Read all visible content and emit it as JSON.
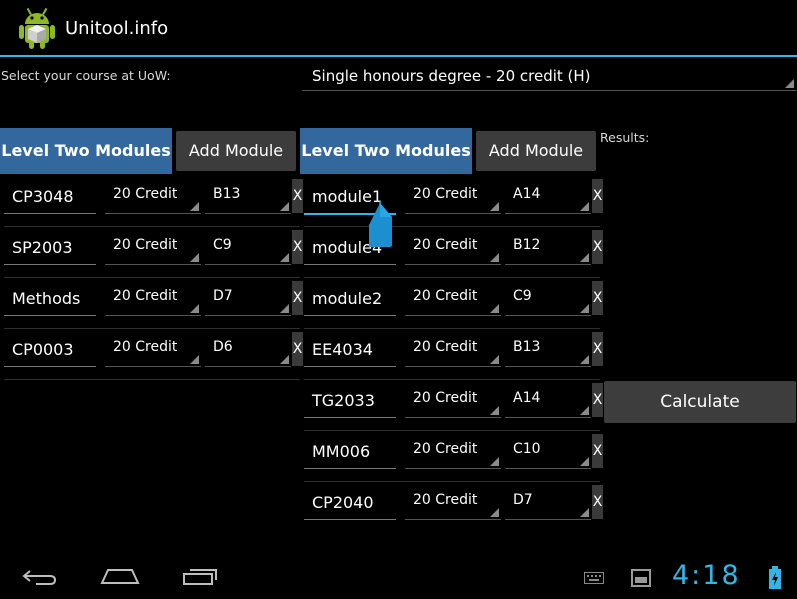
{
  "app": {
    "title": "Unitool.info",
    "accent": "#33b5e5"
  },
  "course": {
    "label": "Select your course at UoW:",
    "selected": "Single honours degree - 20 credit (H)"
  },
  "left_panel": {
    "header": "Level Two Modules",
    "add_label": "Add Module",
    "rows": [
      {
        "name": "CP3048",
        "credit": "20 Credit",
        "grade": "B13",
        "delete": "X"
      },
      {
        "name": "SP2003",
        "credit": "20 Credit",
        "grade": "C9",
        "delete": "X"
      },
      {
        "name": "Methods",
        "credit": "20 Credit",
        "grade": "D7",
        "delete": "X"
      },
      {
        "name": "CP0003",
        "credit": "20 Credit",
        "grade": "D6",
        "delete": "X"
      }
    ]
  },
  "right_panel": {
    "header": "Level Two Modules",
    "add_label": "Add Module",
    "rows": [
      {
        "name": "module1",
        "credit": "20 Credit",
        "grade": "A14",
        "delete": "X"
      },
      {
        "name": "module4",
        "credit": "20 Credit",
        "grade": "B12",
        "delete": "X"
      },
      {
        "name": "module2",
        "credit": "20 Credit",
        "grade": "C9",
        "delete": "X"
      },
      {
        "name": "EE4034",
        "credit": "20 Credit",
        "grade": "B13",
        "delete": "X"
      },
      {
        "name": "TG2033",
        "credit": "20 Credit",
        "grade": "A14",
        "delete": "X"
      },
      {
        "name": "MM006",
        "credit": "20 Credit",
        "grade": "C10",
        "delete": "X"
      },
      {
        "name": "CP2040",
        "credit": "20 Credit",
        "grade": "D7",
        "delete": "X"
      }
    ]
  },
  "results": {
    "label": "Results:",
    "calculate_label": "Calculate"
  },
  "status": {
    "time": "4:18"
  },
  "icons": [
    "android-logo-icon",
    "back-icon",
    "home-icon",
    "recent-apps-icon",
    "keyboard-icon",
    "screenshot-icon",
    "battery-icon"
  ]
}
